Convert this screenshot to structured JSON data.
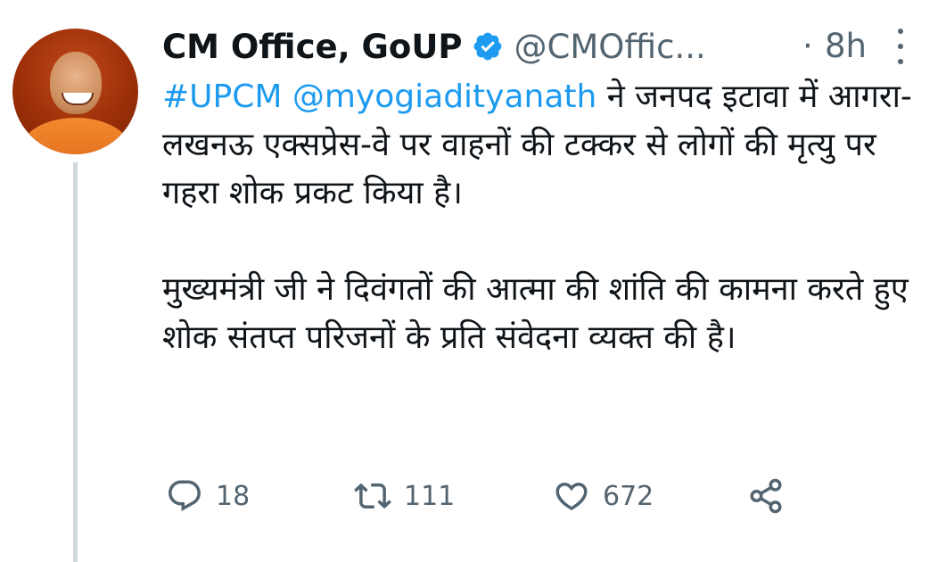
{
  "tweet": {
    "author": {
      "display_name": "CM Office, GoUP",
      "handle": "@CMOffic...",
      "verified": true
    },
    "separator": "·",
    "time": "8h",
    "text": {
      "hashtag": "#UPCM",
      "mention": "@myogiadityanath",
      "line1_rest": " ने जनपद इटावा में आगरा-लखनऊ एक्सप्रेस-वे पर वाहनों की टक्कर से लोगों की मृत्यु पर गहरा शोक प्रकट किया है।",
      "paragraph2": "मुख्यमंत्री जी ने दिवंगतों की आत्मा की शांति की कामना करते हुए शोक संतप्त परिजनों के प्रति संवेदना व्यक्त की है।"
    },
    "actions": {
      "replies": "18",
      "retweets": "111",
      "likes": "672"
    },
    "icons": {
      "verified": "verified-badge-icon",
      "reply": "reply-icon",
      "retweet": "retweet-icon",
      "like": "heart-icon",
      "share": "share-icon",
      "more": "more-vertical-icon"
    },
    "colors": {
      "link": "#1d9bf0",
      "secondary_text": "#536471",
      "primary_text": "#0f1419",
      "thread_line": "#cfd9de"
    }
  }
}
